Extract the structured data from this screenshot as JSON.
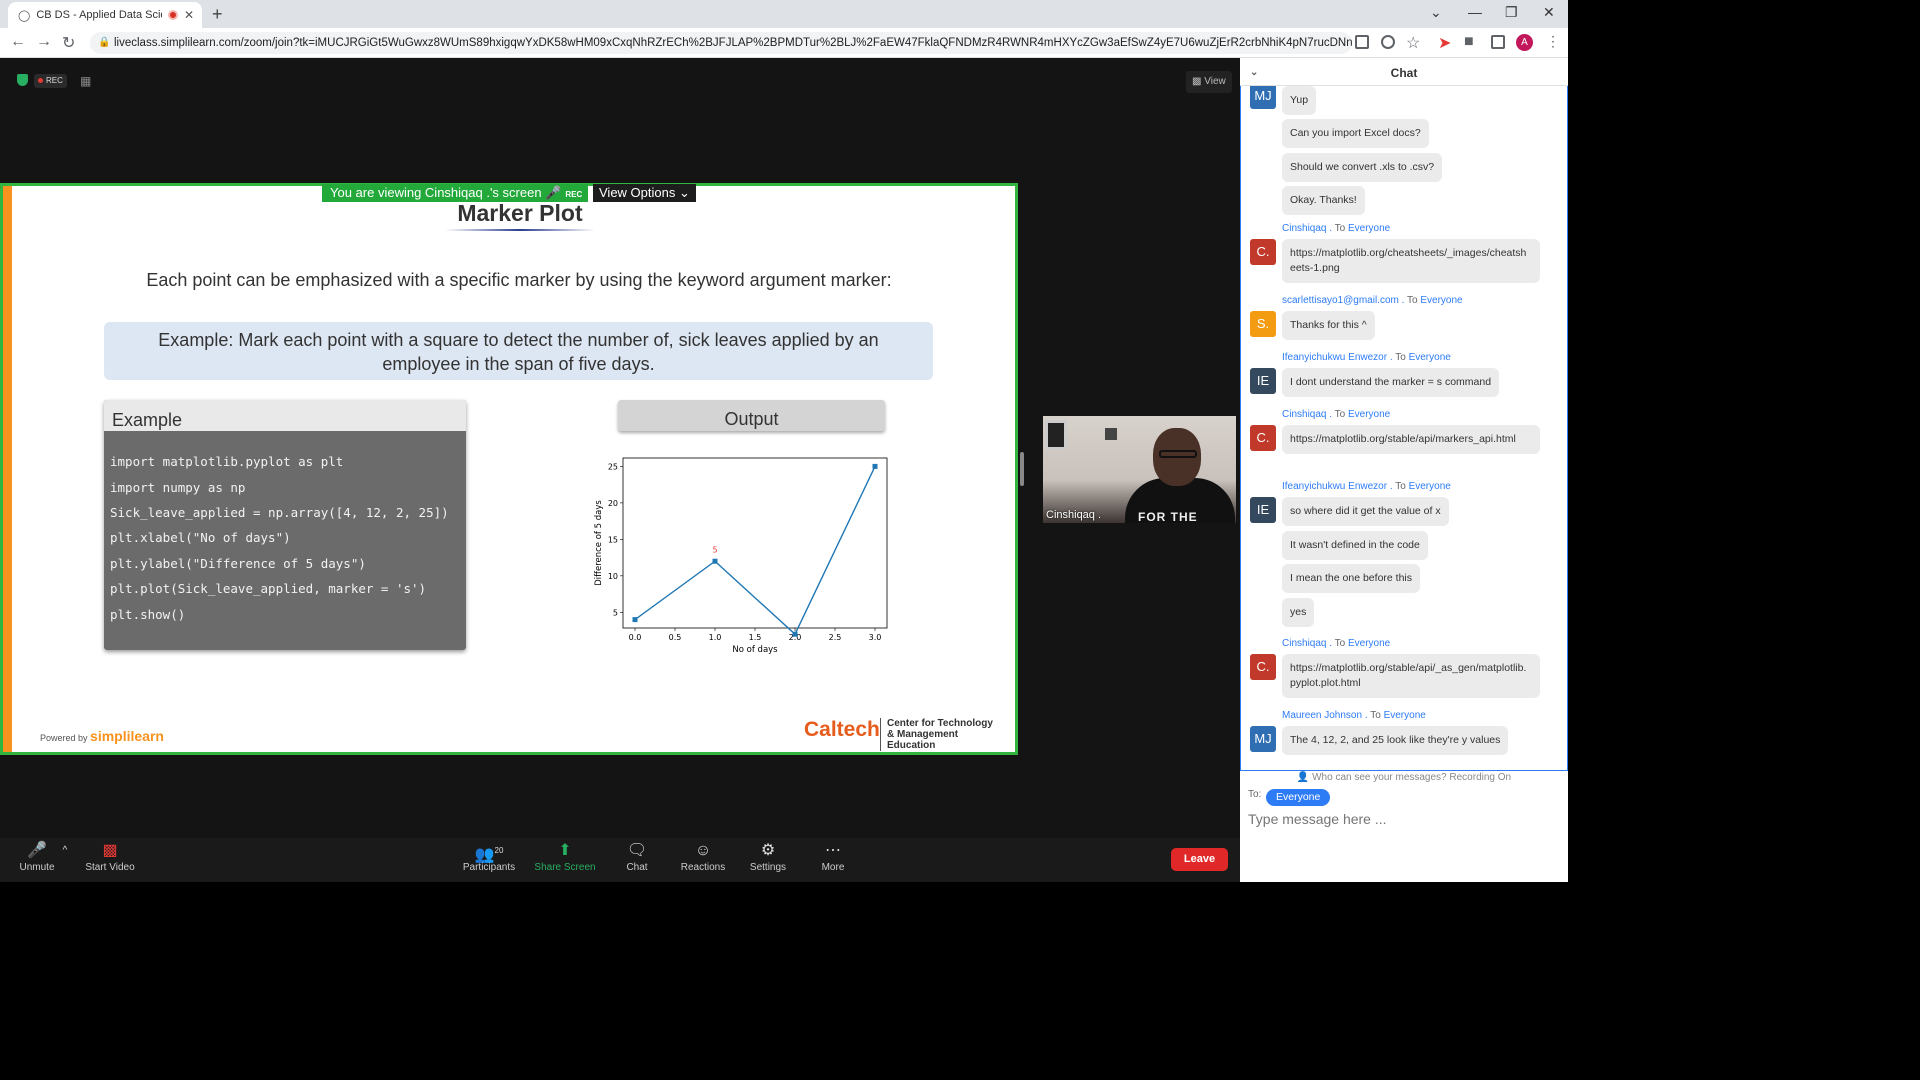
{
  "browser": {
    "tab_title": "CB DS - Applied Data Scienc",
    "url": "liveclass.simplilearn.com/zoom/join?tk=iMUCJRGiGt5WuGwxz8WUmS89hxigqwYxDK58wHM09xCxqNhRZrECh%2BJFJLAP%2BPMDTur%2BLJ%2FaEW47FklaQFNDMzR4RWNR4mHXYcZGw3aEfSwZ4yE7U6wuZjErR2crbNhiK4pN7rucDNn5pcxSOy6...",
    "avatar_letter": "A"
  },
  "meeting": {
    "rec_label": "REC",
    "view_label": "View",
    "viewing_banner": "You are viewing Cinshiqaq .'s screen",
    "banner_rec": "REC",
    "view_options": "View Options"
  },
  "slide": {
    "title": "Marker Plot",
    "subtitle": "Each point can be emphasized with a specific marker by using the keyword argument marker:",
    "example_text": "Example: Mark each point with a square to detect the number of, sick leaves applied by an employee in the span of five days.",
    "code_header": "Example",
    "code_lines": [
      "import matplotlib.pyplot as plt",
      "import numpy as np",
      "Sick_leave_applied = np.array([4, 12, 2, 25])",
      "plt.xlabel(\"No of days\")",
      "plt.ylabel(\"Difference of 5 days\")",
      "plt.plot(Sick_leave_applied, marker = 's')",
      "plt.show()"
    ],
    "output_header": "Output",
    "powered_by": "Powered by",
    "brand": "simplilearn",
    "caltech": "Caltech",
    "caltech_sub": "Center for Technology & Management Education"
  },
  "chart_data": {
    "type": "line",
    "x": [
      0.0,
      1.0,
      2.0,
      3.0
    ],
    "series": [
      {
        "values": [
          4,
          12,
          2,
          25
        ],
        "color": "#1f77b4",
        "marker": "s"
      }
    ],
    "xlabel": "No of days",
    "ylabel": "Difference of 5 days",
    "xticks": [
      "0.0",
      "0.5",
      "1.0",
      "1.5",
      "2.0",
      "2.5",
      "3.0"
    ],
    "yticks": [
      "5",
      "10",
      "15",
      "20",
      "25"
    ],
    "xlim": [
      -0.15,
      3.15
    ],
    "ylim": [
      2.85,
      26.15
    ],
    "annotation": "5"
  },
  "video": {
    "name": "Cinshiqaq .",
    "shirt_text": "FOR THE"
  },
  "toolbar": {
    "unmute": "Unmute",
    "start_video": "Start Video",
    "participants": "Participants",
    "participant_count": "20",
    "share_screen": "Share Screen",
    "chat": "Chat",
    "reactions": "Reactions",
    "settings": "Settings",
    "more": "More",
    "leave": "Leave"
  },
  "chat": {
    "title": "Chat",
    "messages": [
      {
        "text": "Yup"
      },
      {
        "text": "Can you import Excel docs?"
      },
      {
        "text": "Should we convert .xls to .csv?"
      },
      {
        "text": "Okay. Thanks!"
      },
      {
        "sender": "Cinshiqaq .",
        "to": "To",
        "recipient": "Everyone",
        "initials": "C.",
        "text": "https://matplotlib.org/cheatsheets/_images/cheatsheets-1.png"
      },
      {
        "sender": "scarlettisayo1@gmail.com .",
        "to": "To",
        "recipient": "Everyone",
        "initials": "S.",
        "text": "Thanks for this ^"
      },
      {
        "sender": "Ifeanyichukwu Enwezor .",
        "to": "To",
        "recipient": "Everyone",
        "initials": "IE",
        "text": "I dont understand the marker = s command"
      },
      {
        "sender": "Cinshiqaq .",
        "to": "To",
        "recipient": "Everyone",
        "initials": "C.",
        "text": "https://matplotlib.org/stable/api/markers_api.html"
      },
      {
        "sender": "Ifeanyichukwu Enwezor .",
        "to": "To",
        "recipient": "Everyone",
        "initials": "IE",
        "text": "so where did it get the value of x"
      },
      {
        "text": "It wasn't defined in the code"
      },
      {
        "text": "I mean the one before this"
      },
      {
        "text": "yes"
      },
      {
        "sender": "Cinshiqaq .",
        "to": "To",
        "recipient": "Everyone",
        "initials": "C.",
        "text": "https://matplotlib.org/stable/api/_as_gen/matplotlib.pyplot.plot.html"
      },
      {
        "sender": "Maureen Johnson .",
        "to": "To",
        "recipient": "Everyone",
        "initials": "MJ",
        "text": "The 4, 12, 2, and 25 look like they're y values"
      }
    ],
    "first_initials": "MJ",
    "who_can_see": "Who can see your messages? Recording On",
    "to_label": "To:",
    "to_value": "Everyone",
    "input_placeholder": "Type message here ..."
  },
  "colors": {
    "accent": "#2d7cf6",
    "leave": "#e02828",
    "share": "#27ae60",
    "slide_border": "#31b53e",
    "orange": "#f7931e"
  }
}
